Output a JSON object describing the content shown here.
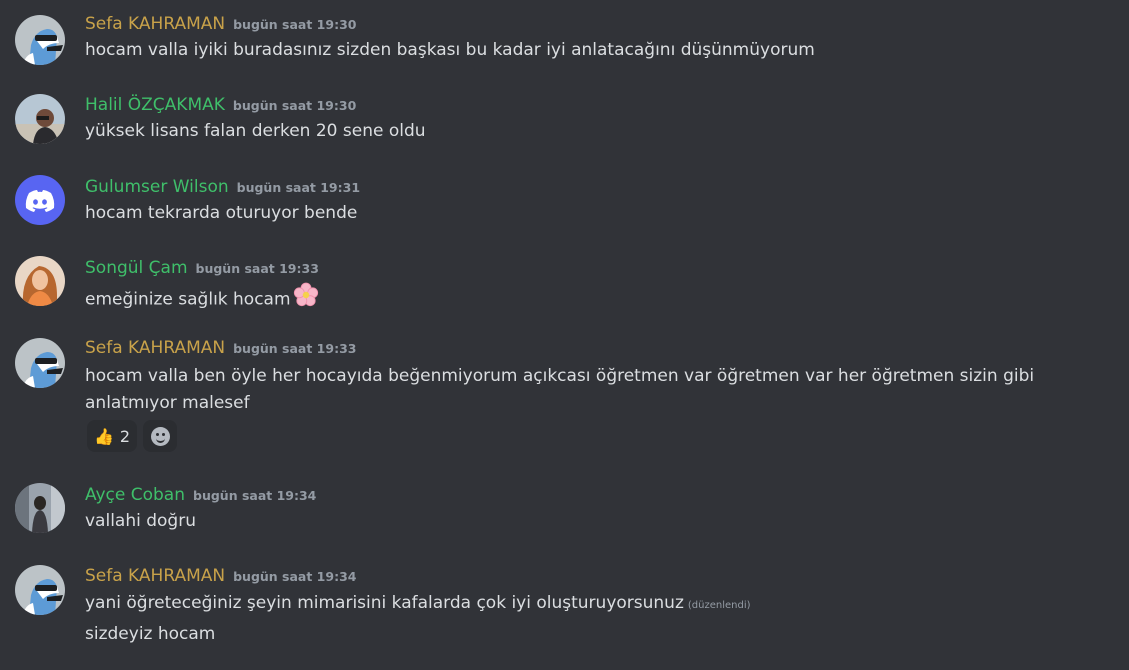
{
  "colors": {
    "background": "#313338",
    "name_gold": "#c8a24a",
    "name_green": "#3fbf6a",
    "timestamp": "#949ba4",
    "text": "#dbdee1",
    "discord_blurple": "#5865f2"
  },
  "messages": [
    {
      "author": "Sefa KAHRAMAN",
      "name_color": "gold",
      "avatar": "bird-avatar",
      "timestamp": "bugün saat 19:30",
      "lines": [
        "hocam valla iyiki buradasınız sizden başkası bu kadar iyi anlatacağını düşünmüyorum"
      ]
    },
    {
      "author": "Halil ÖZÇAKMAK",
      "name_color": "green",
      "avatar": "man-photo-avatar",
      "timestamp": "bugün saat 19:30",
      "lines": [
        "yüksek lisans falan derken 20 sene oldu"
      ]
    },
    {
      "author": "Gulumser Wilson",
      "name_color": "green",
      "avatar": "discord-default-avatar",
      "timestamp": "bugün saat 19:31",
      "lines": [
        "hocam tekrarda oturuyor bende"
      ]
    },
    {
      "author": "Songül Çam",
      "name_color": "green",
      "avatar": "woman-photo-avatar",
      "timestamp": "bugün saat 19:33",
      "lines": [
        "emeğinize sağlık hocam"
      ],
      "emoji": "cherry-blossom-icon"
    },
    {
      "author": "Sefa KAHRAMAN",
      "name_color": "gold",
      "avatar": "bird-avatar",
      "timestamp": "bugün saat 19:33",
      "lines": [
        "hocam valla ben öyle her hocayıda beğenmiyorum açıkcası öğretmen var öğretmen var her öğretmen sizin gibi anlatmıyor malesef"
      ],
      "reactions": [
        {
          "emoji": "👍",
          "count": "2"
        }
      ]
    },
    {
      "author": "Ayçe Coban",
      "name_color": "green",
      "avatar": "woman-street-photo-avatar",
      "timestamp": "bugün saat 19:34",
      "lines": [
        "vallahi doğru"
      ]
    },
    {
      "author": "Sefa KAHRAMAN",
      "name_color": "gold",
      "avatar": "bird-avatar",
      "timestamp": "bugün saat 19:34",
      "lines": [
        "yani öğreteceğiniz şeyin mimarisini kafalarda çok iyi oluşturuyorsunuz",
        "sizdeyiz hocam"
      ],
      "edited_label": "(düzenlendi)"
    }
  ]
}
